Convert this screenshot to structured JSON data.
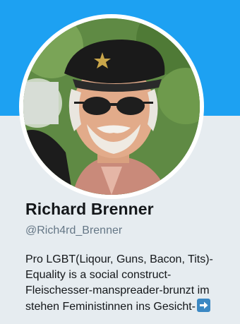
{
  "profile": {
    "display_name": "Richard Brenner",
    "handle": "@Rich4rd_Brenner",
    "bio_lines": [
      "Pro LGBT(Liqour, Guns, Bacon, Tits)-",
      "Equality is a social construct-",
      "Fleischesser-manspreader-brunzt im",
      "stehen Feministinnen ins Gesicht-"
    ],
    "bio_trailing_icon": "right-arrow-emoji-icon"
  },
  "colors": {
    "banner": "#1da1f2",
    "background": "#e6ecf0",
    "name": "#14171a",
    "handle": "#657786",
    "arrow_emoji": "#3b88c3"
  }
}
